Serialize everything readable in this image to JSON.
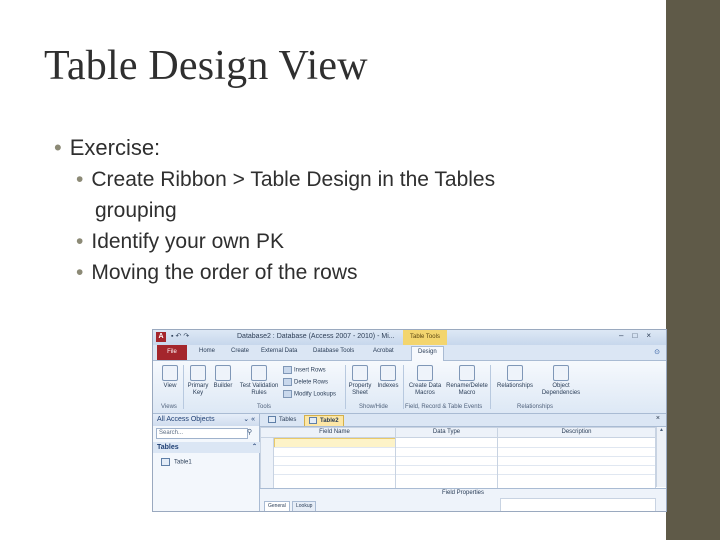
{
  "slide": {
    "title": "Table Design View",
    "bullets": {
      "level1": "Exercise:",
      "level2": [
        "Create Ribbon > Table Design in the Tables",
        "grouping",
        "Identify your own PK",
        "Moving the order of the rows"
      ]
    }
  },
  "colors": {
    "sidebar": "#5f5a48",
    "text": "#2f2f2f",
    "bullet": "#8c8a76",
    "file_tab": "#a4262c",
    "context_tab": "#f3d56e"
  },
  "screenshot": {
    "window_title": "Database2 : Database (Access 2007 - 2010) - Mi...",
    "context_tab": "Table Tools",
    "qat_icons": [
      "save-icon",
      "undo-icon",
      "redo-icon"
    ],
    "window_buttons": [
      "minimize",
      "maximize",
      "close"
    ],
    "tabs": [
      "File",
      "Home",
      "Create",
      "External Data",
      "Database Tools",
      "Acrobat",
      "Design"
    ],
    "ribbon": {
      "view": "View",
      "primary_key": "Primary Key",
      "builder": "Builder",
      "test_validation": "Test Validation Rules",
      "insert_rows": "Insert Rows",
      "delete_rows": "Delete Rows",
      "modify_lookups": "Modify Lookups",
      "property_sheet": "Property Sheet",
      "indexes": "Indexes",
      "create_data_macros": "Create Data Macros",
      "rename_delete_macro": "Rename/Delete Macro",
      "relationships": "Relationships",
      "object_dependencies": "Object Dependencies",
      "groups": [
        "Views",
        "Tools",
        "Show/Hide",
        "Field, Record & Table Events",
        "Relationships"
      ]
    },
    "nav": {
      "header": "All Access Objects",
      "search_placeholder": "Search...",
      "section": "Tables",
      "items": [
        "Table1"
      ]
    },
    "doc_tabs": [
      "Tables",
      "Table2"
    ],
    "grid_headers": [
      "Field Name",
      "Data Type",
      "Description"
    ],
    "field_properties": "Field Properties",
    "property_tabs": [
      "General",
      "Lookup"
    ]
  }
}
